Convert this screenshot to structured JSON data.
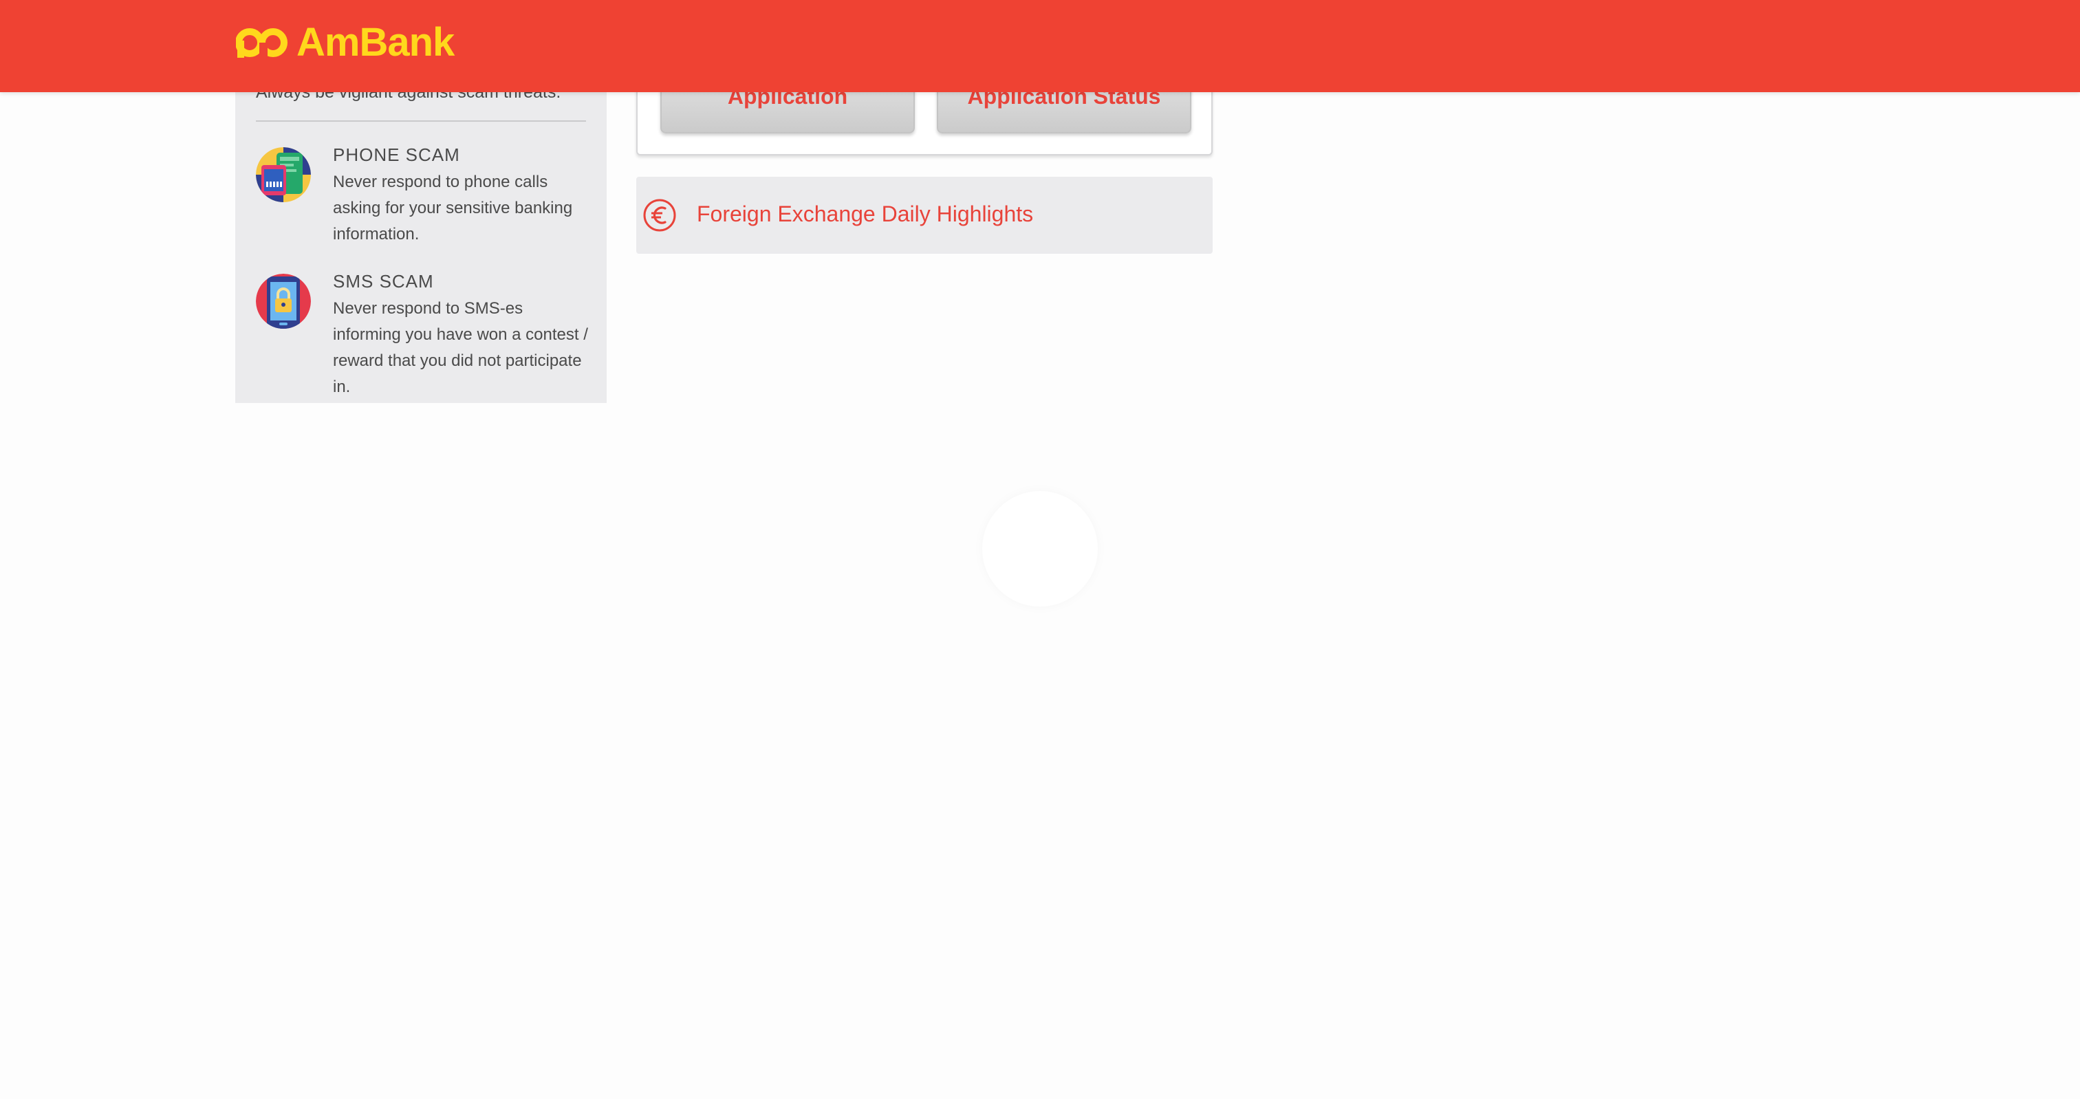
{
  "header": {
    "brand_name": "AmBank",
    "logo_icon": "ambank-logo-icon",
    "background_color": "#ef4233",
    "brand_color": "#ffd81c"
  },
  "scam_panel": {
    "intro_text": "Always be vigilant against scam threats.",
    "items": [
      {
        "title": "PHONE SCAM",
        "description": "Never respond to phone calls asking for your sensitive banking information.",
        "icon": "phone-scam-icon"
      },
      {
        "title": "SMS SCAM",
        "description": "Never respond to SMS-es informing you have won a contest / reward that you did not participate in.",
        "icon": "sms-scam-icon"
      }
    ]
  },
  "application_card": {
    "apply_label": "Application",
    "status_label": "Application Status"
  },
  "fx_link": {
    "label": "Foreign Exchange Daily Highlights",
    "icon": "euro-icon"
  },
  "accent_color": "#e8433a"
}
